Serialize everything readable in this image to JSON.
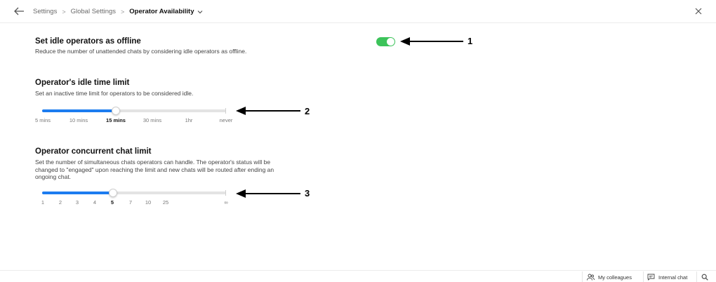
{
  "header": {
    "breadcrumb": [
      "Settings",
      "Global Settings"
    ],
    "current": "Operator Availability",
    "separator": ">"
  },
  "idle_offline": {
    "title": "Set idle operators as offline",
    "description": "Reduce the number of unattended chats by considering idle operators as offline.",
    "enabled": true,
    "toggle_color": "#3cc35a"
  },
  "idle_time": {
    "title": "Operator's idle time limit",
    "description": "Set an inactive time limit for operators to be considered idle.",
    "ticks": [
      "5 mins",
      "10 mins",
      "15 mins",
      "30 mins",
      "1hr",
      "never"
    ],
    "selected": "15 mins",
    "level_fraction": 0.4
  },
  "concurrent": {
    "title": "Operator concurrent chat limit",
    "description_lines": [
      "Set the number of simultaneous chats operators can handle. The operator's status will be",
      "changed to \"engaged\" upon reaching the limit and new chats will be routed after ending an",
      "ongoing chat."
    ],
    "ticks": [
      "1",
      "2",
      "3",
      "4",
      "5",
      "7",
      "10",
      "25",
      "∞"
    ],
    "selected": "5",
    "level_fraction": 0.385
  },
  "annotations": [
    "1",
    "2",
    "3"
  ],
  "footer": {
    "colleagues": "My colleagues",
    "internal_chat": "Internal chat"
  },
  "colors": {
    "accent": "#1c7cf0",
    "toggle_on": "#3cc35a"
  },
  "icons": [
    "back-arrow-icon",
    "chevron-down-icon",
    "close-icon",
    "colleagues-icon",
    "chat-bubble-icon",
    "search-icon"
  ]
}
